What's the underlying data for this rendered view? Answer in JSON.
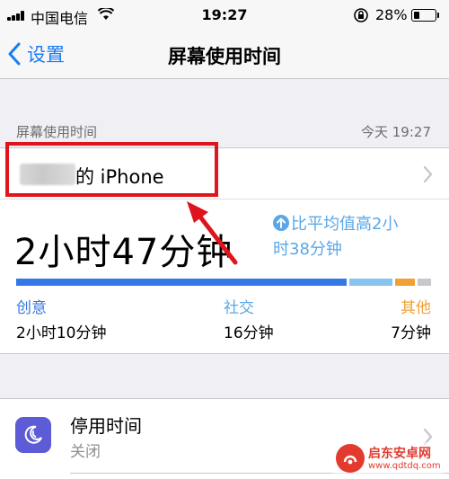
{
  "status_bar": {
    "carrier": "中国电信",
    "time": "19:27",
    "battery_percent": "28%",
    "battery_level": 0.28,
    "icons": [
      "signal-icon",
      "wifi-icon",
      "orientation-lock-icon",
      "battery-icon"
    ]
  },
  "nav": {
    "back_label": "设置",
    "title": "屏幕使用时间"
  },
  "section": {
    "label": "屏幕使用时间",
    "timestamp": "今天 19:27"
  },
  "device": {
    "name_suffix": "的 iPhone"
  },
  "usage": {
    "total": "2小时47分钟",
    "compare_line1": "比平均值高2小",
    "compare_line2": "时38分钟",
    "categories": [
      {
        "label": "创意",
        "duration": "2小时10分钟",
        "color": "#3478e5"
      },
      {
        "label": "社交",
        "duration": "16分钟",
        "color": "#86c4ef"
      },
      {
        "label": "其他",
        "duration": "7分钟",
        "color": "#f0a133"
      }
    ],
    "remainder_color": "#c7c7cc"
  },
  "downtime": {
    "title": "停用时间",
    "status": "关闭"
  },
  "watermark": {
    "name": "启东安卓网",
    "url": "www.qdtdq.com"
  },
  "colors": {
    "accent": "#1a7cf5",
    "highlight": "#e0141d",
    "downtime_icon_bg": "#5d5cd6"
  }
}
